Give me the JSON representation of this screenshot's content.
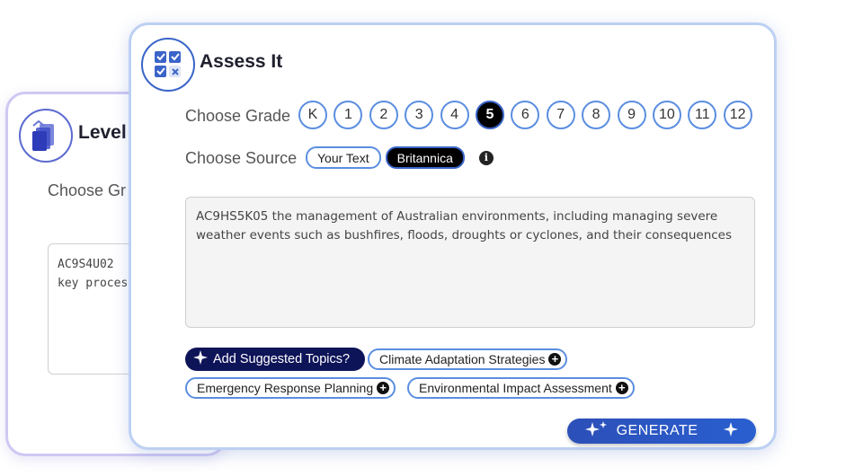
{
  "back_card": {
    "title": "Level",
    "choose_label": "Choose Gr",
    "text_line1": "AC9S4U02",
    "text_line2": "key process"
  },
  "main_card": {
    "title": "Assess It",
    "grade_label": "Choose Grade",
    "grades": [
      "K",
      "1",
      "2",
      "3",
      "4",
      "5",
      "6",
      "7",
      "8",
      "9",
      "10",
      "11",
      "12"
    ],
    "selected_grade": "5",
    "source_label": "Choose Source",
    "sources": [
      "Your Text",
      "Britannica"
    ],
    "selected_source": "Britannica",
    "info_glyph": "i",
    "text_content": "AC9HS5K05 the management of Australian environments, including managing severe weather events such as bushfires, floods, droughts or cyclones, and their consequences",
    "suggest_button": "Add Suggested Topics?",
    "topics": [
      "Climate Adaptation Strategies",
      "Emergency Response Planning",
      "Environmental Impact Assessment"
    ],
    "generate_label": "GENERATE"
  },
  "colors": {
    "accent": "#5b8ee0",
    "dark_navy": "#0e1458",
    "generate_blue": "#2c4fb8",
    "back_border": "#cfc8f3",
    "main_border": "#bcd0f2"
  }
}
